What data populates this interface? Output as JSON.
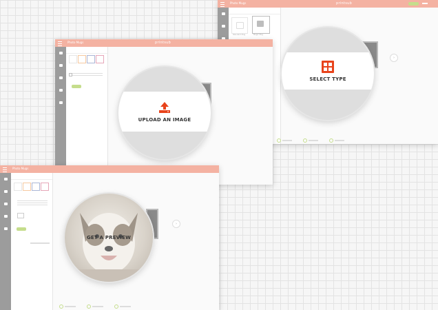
{
  "window_upload": {
    "title": "Photo Mugs",
    "logo": "printsub",
    "step_label": "UPLOAD AN IMAGE",
    "icon": "upload-icon",
    "accent": "#e8431b"
  },
  "window_select": {
    "title": "Photo Mugs",
    "logo": "printsub",
    "step_label": "SELECT TYPE",
    "icon": "grid-icon",
    "accent": "#e8431b",
    "product_a": "Standard Mug",
    "product_b": "Magic Mug"
  },
  "window_preview": {
    "title": "Photo Mugs",
    "step_label": "GET A PREVIEW",
    "icon": "dog-photo"
  },
  "colors": {
    "topbar": "#f4b2a2",
    "sidebar": "#9c9c9c",
    "green": "#c5dd8c",
    "accent": "#e8431b"
  }
}
